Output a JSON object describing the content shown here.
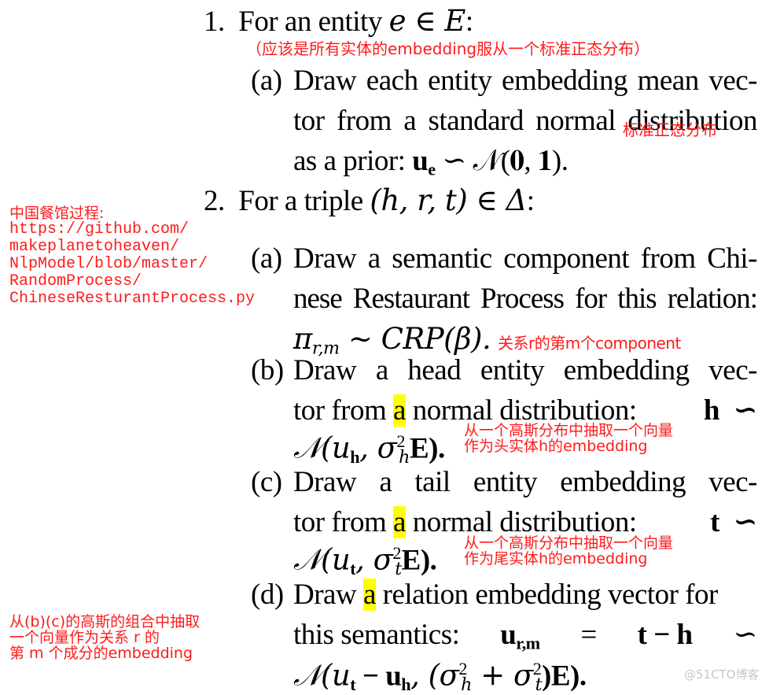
{
  "step1": {
    "label": "1.",
    "text": "For an entity ",
    "math": "e ∈ E",
    "colon": ":",
    "annotation": "（应该是所有实体的embedding服从一个标准正态分布）",
    "a": {
      "label": "(a)",
      "lines": [
        "Draw each entity embedding mean vec-",
        "tor from a standard normal distribution"
      ],
      "line3_text": "as a prior: ",
      "line3_math_u": "u",
      "line3_math_sub": "e",
      "line3_math_rest": " ∽ 𝒩(𝟎, 𝟏).",
      "annotation": "标准正态分布"
    }
  },
  "step2": {
    "label": "2.",
    "text": "For a triple ",
    "math": "(h, r, t) ∈ Δ",
    "colon": ":",
    "side_annotation": [
      "中国餐馆过程:",
      "https://github.com/",
      "makeplanetoheaven/",
      "NlpModel/blob/master/",
      "RandomProcess/",
      "ChineseResturantProcess.py"
    ],
    "a": {
      "label": "(a)",
      "lines": [
        "Draw a semantic component from Chi-",
        "nese Restaurant Process for this relation:"
      ],
      "math_pi": "π",
      "math_pi_sub": "r,m",
      "math_rest": " ∼ CRP(β).",
      "annotation": "关系r的第m个component"
    },
    "b": {
      "label": "(b)",
      "line1": [
        "Draw",
        "a",
        "head",
        "entity",
        "embedding",
        "vec-"
      ],
      "line2_pre": "tor from ",
      "line2_hl": "a",
      "line2_post": " normal distribution:",
      "line2_math": "h  ∽",
      "line3_math": "𝒩(u",
      "line3_sub": "h",
      "line3_mid": ", σ",
      "line3_sup": "2",
      "line3_sub2": "h",
      "line3_end": "E).",
      "annotation": [
        "从一个高斯分布中抽取一个向量",
        "作为头实体h的embedding"
      ]
    },
    "c": {
      "label": "(c)",
      "line1": [
        "Draw",
        "a",
        "tail",
        "entity",
        "embedding",
        "vec-"
      ],
      "line2_pre": "tor from ",
      "line2_hl": "a",
      "line2_post": " normal distribution:",
      "line2_math": "t  ∽",
      "line3_math": "𝒩(u",
      "line3_sub": "t",
      "line3_mid": ", σ",
      "line3_sup": "2",
      "line3_sub2": "t",
      "line3_end": "E).",
      "annotation": [
        "从一个高斯分布中抽取一个向量",
        "作为尾实体h的embedding"
      ]
    },
    "d": {
      "label": "(d)",
      "line1_pre": "Draw ",
      "line1_hl": "a",
      "line1_post": " relation embedding vector for",
      "line2_text": "this semantics:",
      "line2_u": "u",
      "line2_sub": "r,m",
      "line2_eq": "=",
      "line2_rhs": "t − h",
      "line2_sim": "∽",
      "line3": "𝒩(u",
      "line3_sub_t": "t",
      "line3_minus": " − u",
      "line3_sub_h": "h",
      "line3_comma": ", (σ",
      "line3_sup1": "2",
      "line3_sub1": "h",
      "line3_plus": " + σ",
      "line3_sup2": "2",
      "line3_sub2": "t",
      "line3_end": ")E).",
      "side_annotation": [
        "从(b)(c)的高斯的组合中抽取",
        "一个向量作为关系 r 的",
        "第 m 个成分的embedding"
      ]
    }
  },
  "watermark": "@51CTO博客",
  "colors": {
    "annotation": "#ff1a1a",
    "highlight": "#ffff00",
    "watermark": "#c8c8c8"
  }
}
